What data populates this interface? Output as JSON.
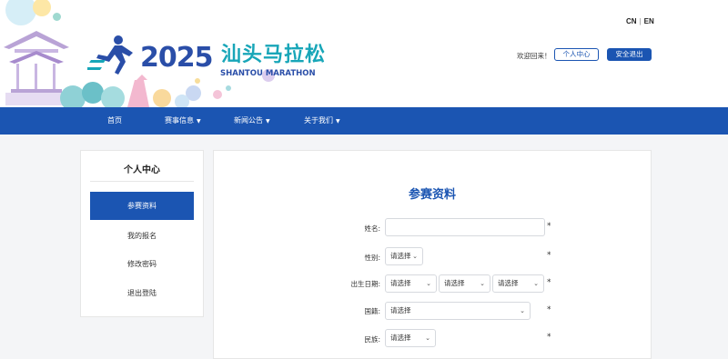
{
  "header": {
    "logo": {
      "year": "2025",
      "name_cn": "汕头马拉松",
      "name_en": "SHANTOU MARATHON"
    },
    "lang": {
      "cn": "CN",
      "en": "EN"
    },
    "welcome": "欢迎回来！",
    "center_label": "个人中心",
    "logout_label": "安全退出"
  },
  "nav": {
    "items": [
      {
        "label": "首页"
      },
      {
        "label": "赛事信息"
      },
      {
        "label": "新闻公告"
      },
      {
        "label": "关于我们"
      }
    ]
  },
  "sidebar": {
    "title": "个人中心",
    "items": [
      {
        "label": "参赛资料"
      },
      {
        "label": "我的报名"
      },
      {
        "label": "修改密码"
      },
      {
        "label": "退出登陆"
      }
    ]
  },
  "main": {
    "title": "参赛资料",
    "fields": {
      "name_label": "姓名:",
      "name_value": "",
      "gender_label": "性别:",
      "gender_value": "请选择",
      "birth_label": "出生日期:",
      "birth_year": "请选择",
      "birth_month": "请选择",
      "birth_day": "请选择",
      "nation_label": "国籍:",
      "nation_value": "请选择",
      "ethnic_label": "民族:",
      "ethnic_value": "请选择"
    },
    "required_mark": "*"
  },
  "colors": {
    "primary": "#1b55b2",
    "logo_teal": "#18a6b8",
    "page_bg": "#f4f5f7"
  },
  "icons": [
    "runner-logo-icon",
    "chevron-down-icon"
  ]
}
